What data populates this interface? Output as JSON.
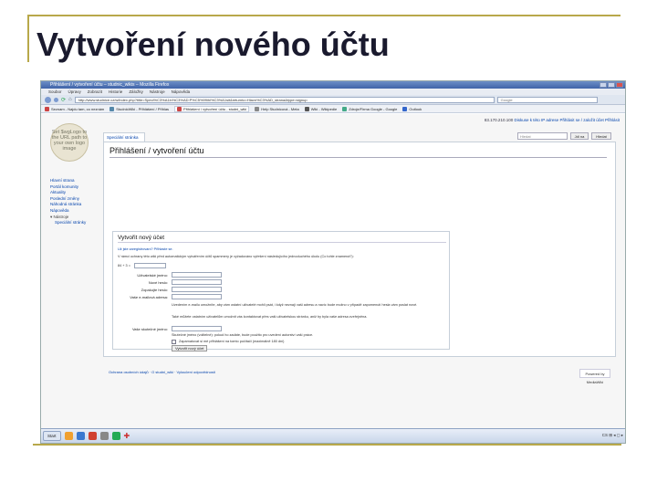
{
  "slide": {
    "title": "Vytvoření nového účtu"
  },
  "browser": {
    "window_title": "Přihlášení / vytvoření účtu – studnic_wikis – Mozilla Firefox",
    "menu": [
      "Soubor",
      "Úpravy",
      "Zobrazit",
      "Historie",
      "Záložky",
      "Nástroje",
      "Nápověda"
    ],
    "url": "http://www.studnice.cz/w/index.php?title=Speci%C3%A1ln%C3%AD:P%C5%99ihl%C3%A1sit&returnto=Hlavn%C3%AD_strana&type=signup",
    "search_placeholder": "Google",
    "bookmarks": [
      {
        "label": "Seznam - Najdu tam, co neznám",
        "active": false
      },
      {
        "label": "StudnicWiki - Přihlášení / Přihlas",
        "active": false
      },
      {
        "label": "Přihlášení / vytvoření účtu - studni_wiki",
        "active": true
      },
      {
        "label": "Help Studnicová - Meta",
        "active": false
      },
      {
        "label": "Wiki - Wikipedie",
        "active": false
      },
      {
        "label": "Zdroje/Firma Google - Google",
        "active": false
      },
      {
        "label": "Outlook",
        "active": false
      }
    ]
  },
  "wiki": {
    "userbar": {
      "ip": "83.170.210.100",
      "discussion": "Diskuse k této IP adrese",
      "login": "Přihlásit se / založit účet",
      "help": "Přihlásit"
    },
    "logo_text": "Set $wgLogo to the URL path to your own logo image",
    "tab_special": "Speciální stránka",
    "search_field": "Hledat",
    "go_button": "Jdi na",
    "search_button": "Hledat",
    "page_title": "Přihlášení / vytvoření účtu",
    "sidebar": {
      "nav": [
        "Hlavní strana",
        "Portál komunity",
        "Aktuality",
        "Poslední změny",
        "Náhodná stránka",
        "Nápověda"
      ],
      "tools_header": "Nástroje",
      "tools": [
        "Speciální stránky"
      ]
    },
    "form": {
      "title": "Vytvořit nový účet",
      "already": "Už jste zaregistrovaní? Přihlaste se.",
      "notice": "V rámci ochrany této wiki před automatickým vytvářením účtů spammery je vyžadováno vyřešení následujícího jednoduchého úkolu (Co tohle znamená?):",
      "captcha": "84 + 3 =",
      "labels": {
        "username": "Uživatelské jméno:",
        "password": "Nové heslo:",
        "password2": "Zopakujte heslo:",
        "email": "Vaše e-mailová adresa:",
        "realname": "Vaše skutečné jméno:"
      },
      "email_note": "Uvedením e-mailu umožníte, aby vám ostatní uživatelé mohli psát, i když neznají vaši adresu a navíc bude možno v případě zapomenutí hesla vám poslat nové.",
      "email_note2": "Také můžete ostatním uživatelům umožnit vás kontaktovat přes vaši uživatelskou stránku, aniž by byla vaše adresa zveřejněna.",
      "realname_note": "Skutečné jméno (volitelné): pokud ho zadáte, bude použito pro uvedení autorství vaší práce.",
      "remember": "Zapamatovat si mé přihlášení na tomto počítači (maximálně 180 dní)",
      "create_button": "Vytvořit nový účet"
    },
    "footer": {
      "links": "Ochrana osobních údajů · O studni_wiki · Vyloučení odpovědnosti",
      "powered": "Powered by MediaWiki"
    }
  },
  "taskbar": {
    "start": "Start",
    "tray": "CS ⊞ ◂ ◻ ▸"
  }
}
